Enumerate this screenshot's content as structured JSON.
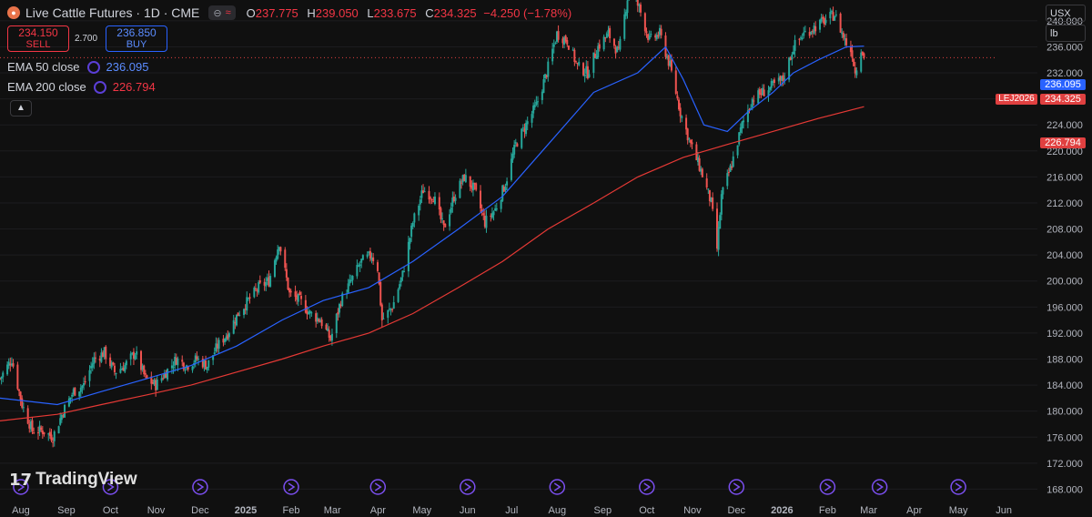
{
  "header": {
    "title": "Live Cattle Futures · 1D · CME",
    "chip_text": "≈",
    "open_label": "O",
    "open": "237.775",
    "high_label": "H",
    "high": "239.050",
    "low_label": "L",
    "low": "233.675",
    "close_label": "C",
    "close": "234.325",
    "change": "−4.250 (−1.78%)"
  },
  "trade": {
    "sell_price": "234.150",
    "sell_label": "SELL",
    "spread": "2.700",
    "buy_price": "236.850",
    "buy_label": "BUY"
  },
  "indicators": [
    {
      "name": "EMA 50 close",
      "value": "236.095",
      "color": "#2962ff"
    },
    {
      "name": "EMA 200 close",
      "value": "226.794",
      "color": "#f23645"
    }
  ],
  "units": {
    "currency": "USX",
    "measure": "lb"
  },
  "price_labels": {
    "ema50": "236.095",
    "last": "234.325",
    "symbol": "LEJ2026",
    "ema200": "226.794"
  },
  "brand": "TradingView",
  "colors": {
    "up": "#26a69a",
    "down": "#ef5350",
    "ema50": "#2962ff",
    "ema200": "#e53935",
    "bg": "#101010"
  },
  "chart_data": {
    "type": "candlestick",
    "title": "Live Cattle Futures · 1D · CME",
    "y_ticks": [
      "168.000",
      "172.000",
      "176.000",
      "180.000",
      "184.000",
      "188.000",
      "192.000",
      "196.000",
      "200.000",
      "204.000",
      "208.000",
      "212.000",
      "216.000",
      "220.000",
      "224.000",
      "228.000",
      "232.000",
      "236.000",
      "240.000"
    ],
    "x_ticks": [
      "Aug",
      "Sep",
      "Oct",
      "Nov",
      "Dec",
      "2025",
      "Feb",
      "Mar",
      "Apr",
      "May",
      "Jun",
      "Jul",
      "Aug",
      "Sep",
      "Oct",
      "Nov",
      "Dec",
      "2026",
      "Feb",
      "Mar",
      "Apr",
      "May",
      "Jun"
    ],
    "ylim": [
      166.8,
      243.2
    ],
    "series": [
      {
        "name": "Price (close)",
        "x": [
          "2024-07-24",
          "2024-08-01",
          "2024-08-08",
          "2024-08-15",
          "2024-08-22",
          "2024-08-29",
          "2024-09-05",
          "2024-09-12",
          "2024-09-19",
          "2024-09-26",
          "2024-10-03",
          "2024-10-10",
          "2024-10-17",
          "2024-10-24",
          "2024-10-31",
          "2024-11-07",
          "2024-11-14",
          "2024-11-21",
          "2024-11-28",
          "2024-12-05",
          "2024-12-12",
          "2024-12-19",
          "2024-12-26",
          "2025-01-02",
          "2025-01-09",
          "2025-01-16",
          "2025-01-23",
          "2025-01-30",
          "2025-02-06",
          "2025-02-13",
          "2025-02-20",
          "2025-02-27",
          "2025-03-06",
          "2025-03-13",
          "2025-03-20",
          "2025-03-27",
          "2025-04-03",
          "2025-04-07",
          "2025-04-10",
          "2025-04-17",
          "2025-04-24",
          "2025-05-01",
          "2025-05-08",
          "2025-05-15",
          "2025-05-22",
          "2025-05-29",
          "2025-06-05",
          "2025-06-12",
          "2025-06-19",
          "2025-06-26",
          "2025-07-03",
          "2025-07-10",
          "2025-07-17",
          "2025-07-24",
          "2025-07-31",
          "2025-08-07",
          "2025-08-14",
          "2025-08-21",
          "2025-08-28",
          "2025-09-04",
          "2025-09-11",
          "2025-09-18",
          "2025-09-25",
          "2025-10-02",
          "2025-10-09",
          "2025-10-16",
          "2025-10-23",
          "2025-10-30",
          "2025-11-06",
          "2025-11-13",
          "2025-11-20",
          "2025-11-24",
          "2025-11-27",
          "2025-12-04",
          "2025-12-11",
          "2025-12-18",
          "2025-12-25",
          "2026-01-01",
          "2026-01-08",
          "2026-01-15",
          "2026-01-22",
          "2026-01-29",
          "2026-02-05",
          "2026-02-12",
          "2026-02-19",
          "2026-02-24",
          "2026-02-26",
          "2026-03-02",
          "2026-03-04"
        ],
        "values": [
          185,
          188,
          181,
          177,
          177,
          176,
          180,
          183,
          184,
          188,
          189,
          186,
          187,
          189,
          185,
          184,
          186,
          188,
          187,
          188,
          187,
          190,
          192,
          195,
          197,
          199,
          200,
          206,
          198,
          197,
          195,
          194,
          191,
          197,
          200,
          203,
          204,
          202,
          194,
          196,
          201,
          209,
          214,
          213,
          208,
          213,
          216,
          214,
          209,
          211,
          215,
          221,
          224,
          227,
          232,
          238,
          237,
          233,
          232,
          236,
          238,
          235,
          245,
          242,
          237,
          238,
          233,
          226,
          221,
          217,
          212,
          205,
          213,
          218,
          224,
          228,
          229,
          230,
          231,
          236,
          238,
          239,
          240,
          241,
          237,
          235,
          232,
          236,
          234.3
        ]
      },
      {
        "name": "EMA 50 close",
        "x": [
          "2024-07-24",
          "2024-09-01",
          "2024-10-01",
          "2024-11-01",
          "2024-12-01",
          "2025-01-01",
          "2025-02-01",
          "2025-03-01",
          "2025-04-01",
          "2025-05-01",
          "2025-06-01",
          "2025-07-01",
          "2025-08-01",
          "2025-09-01",
          "2025-10-01",
          "2025-10-20",
          "2025-11-01",
          "2025-11-15",
          "2025-12-01",
          "2025-12-15",
          "2026-01-01",
          "2026-01-15",
          "2026-02-01",
          "2026-02-20",
          "2026-03-04"
        ],
        "values": [
          182,
          181,
          183,
          185,
          187,
          190,
          194,
          197,
          199,
          203,
          208,
          213,
          221,
          229,
          232,
          236,
          231,
          224,
          223,
          226,
          229,
          232,
          234,
          236,
          236.1
        ]
      },
      {
        "name": "EMA 200 close",
        "x": [
          "2024-07-24",
          "2024-09-01",
          "2024-10-01",
          "2024-11-01",
          "2024-12-01",
          "2025-01-01",
          "2025-02-01",
          "2025-03-01",
          "2025-04-01",
          "2025-05-01",
          "2025-06-01",
          "2025-07-01",
          "2025-08-01",
          "2025-09-01",
          "2025-10-01",
          "2025-11-01",
          "2025-12-01",
          "2026-01-01",
          "2026-02-01",
          "2026-03-04"
        ],
        "values": [
          178.5,
          179.5,
          181,
          182.5,
          184,
          186,
          188,
          190,
          192,
          195,
          199,
          203,
          208,
          212,
          216,
          219,
          221,
          223,
          225,
          226.8
        ]
      }
    ]
  }
}
